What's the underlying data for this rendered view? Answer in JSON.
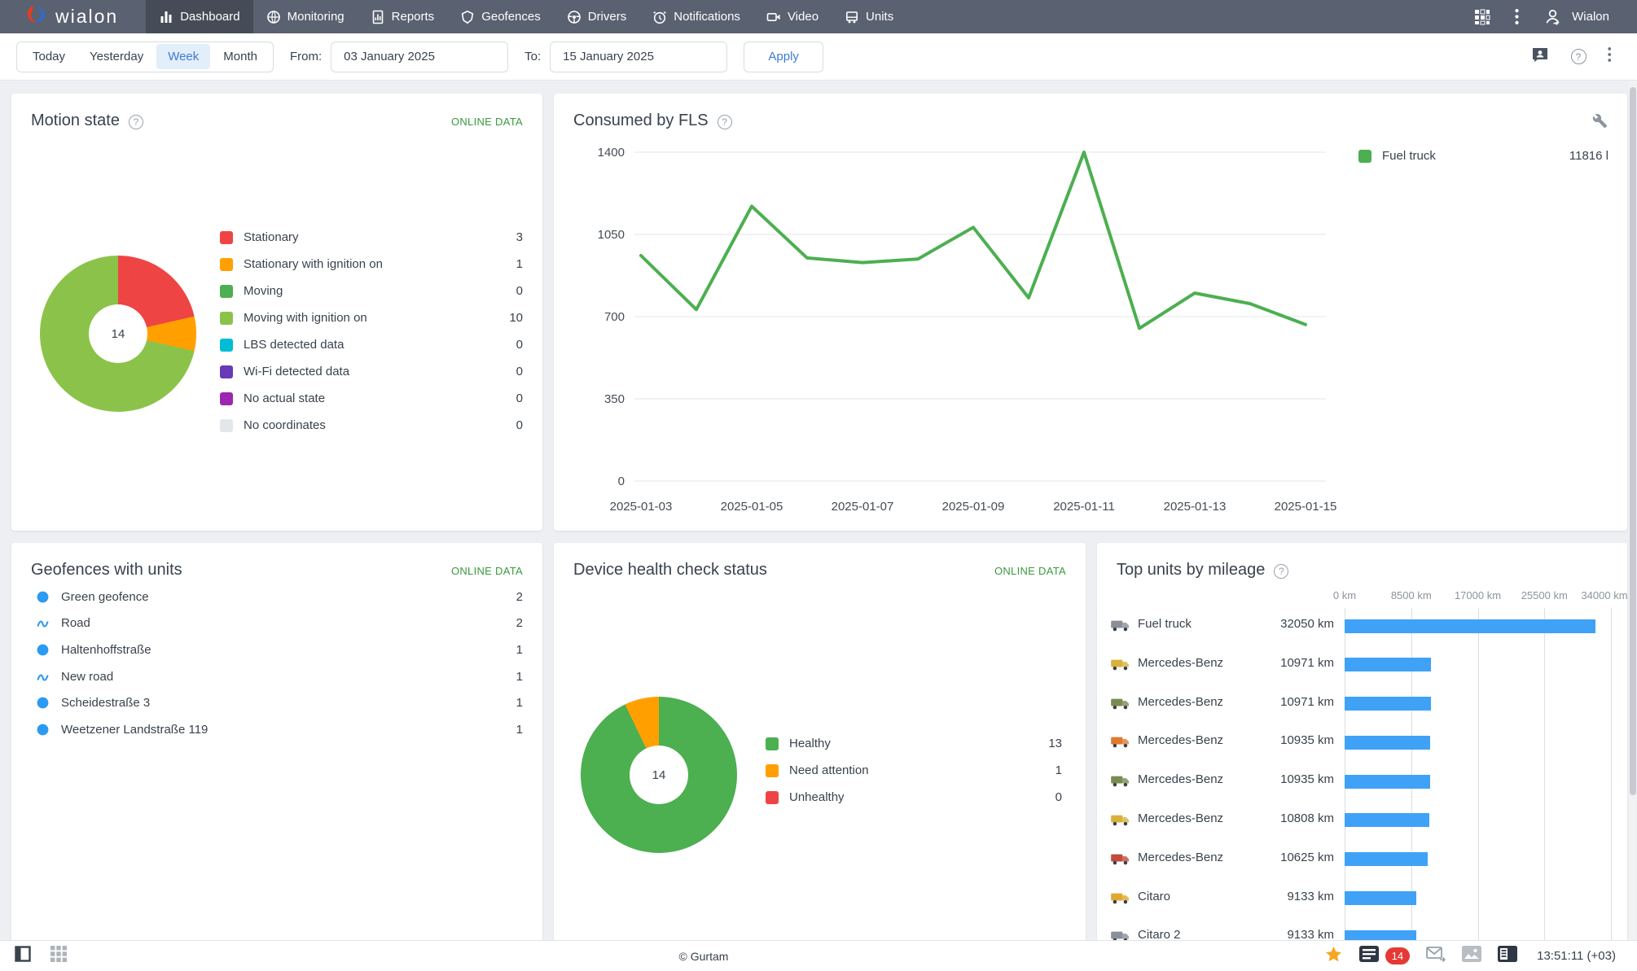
{
  "nav": {
    "brand": "wialon",
    "items": [
      {
        "label": "Dashboard",
        "icon": "dashboard-icon",
        "active": true
      },
      {
        "label": "Monitoring",
        "icon": "monitoring-icon",
        "active": false
      },
      {
        "label": "Reports",
        "icon": "reports-icon",
        "active": false
      },
      {
        "label": "Geofences",
        "icon": "geofences-icon",
        "active": false
      },
      {
        "label": "Drivers",
        "icon": "drivers-icon",
        "active": false
      },
      {
        "label": "Notifications",
        "icon": "notifications-icon",
        "active": false
      },
      {
        "label": "Video",
        "icon": "video-icon",
        "active": false
      },
      {
        "label": "Units",
        "icon": "units-icon",
        "active": false
      }
    ],
    "user_label": "Wialon"
  },
  "filterbar": {
    "ranges": [
      "Today",
      "Yesterday",
      "Week",
      "Month"
    ],
    "active_range": "Week",
    "from_label": "From:",
    "from_value": "03 January 2025",
    "to_label": "To:",
    "to_value": "15 January 2025",
    "apply_label": "Apply"
  },
  "widgets": {
    "motion_state": {
      "title": "Motion state",
      "online_data_label": "ONLINE DATA",
      "center_total": "14",
      "legend": [
        {
          "label": "Stationary",
          "count": "3",
          "color": "#ef4444"
        },
        {
          "label": "Stationary with ignition on",
          "count": "1",
          "color": "#ffa000"
        },
        {
          "label": "Moving",
          "count": "0",
          "color": "#4caf50"
        },
        {
          "label": "Moving with ignition on",
          "count": "10",
          "color": "#8bc34a"
        },
        {
          "label": "LBS detected data",
          "count": "0",
          "color": "#00bcd4"
        },
        {
          "label": "Wi-Fi detected data",
          "count": "0",
          "color": "#673ab7"
        },
        {
          "label": "No actual state",
          "count": "0",
          "color": "#9c27b0"
        },
        {
          "label": "No coordinates",
          "count": "0",
          "color": "#e4e7ea"
        }
      ]
    },
    "fls": {
      "title": "Consumed by FLS",
      "legend_name": "Fuel truck",
      "legend_value": "11816 l",
      "legend_color": "#4caf50"
    },
    "geofences": {
      "title": "Geofences with units",
      "online_data_label": "ONLINE DATA",
      "items": [
        {
          "name": "Green geofence",
          "count": "2",
          "icon": "circle-geofence-icon"
        },
        {
          "name": "Road",
          "count": "2",
          "icon": "route-geofence-icon"
        },
        {
          "name": "Haltenhoffstraße",
          "count": "1",
          "icon": "circle-geofence-icon"
        },
        {
          "name": "New road",
          "count": "1",
          "icon": "route-geofence-icon"
        },
        {
          "name": "Scheidestraße 3",
          "count": "1",
          "icon": "circle-geofence-icon"
        },
        {
          "name": "Weetzener Landstraße 119",
          "count": "1",
          "icon": "circle-geofence-icon"
        }
      ]
    },
    "health": {
      "title": "Device health check status",
      "online_data_label": "ONLINE DATA",
      "center_total": "14",
      "legend": [
        {
          "label": "Healthy",
          "count": "13",
          "color": "#4caf50"
        },
        {
          "label": "Need attention",
          "count": "1",
          "color": "#ffa000"
        },
        {
          "label": "Unhealthy",
          "count": "0",
          "color": "#ef4444"
        }
      ]
    },
    "mileage": {
      "title": "Top units by mileage",
      "axis_labels": [
        "0 km",
        "8500 km",
        "17000 km",
        "25500 km",
        "34000 km"
      ],
      "units": [
        {
          "name": "Fuel truck",
          "value_label": "32050 km",
          "value": 32050,
          "icon": "truck-icon",
          "icon_color": "#8a8f98"
        },
        {
          "name": "Mercedes-Benz",
          "value_label": "10971 km",
          "value": 10971,
          "icon": "truck-icon",
          "icon_color": "#d8b13c"
        },
        {
          "name": "Mercedes-Benz",
          "value_label": "10971 km",
          "value": 10971,
          "icon": "truck-icon",
          "icon_color": "#7a8b52"
        },
        {
          "name": "Mercedes-Benz",
          "value_label": "10935 km",
          "value": 10935,
          "icon": "truck-icon",
          "icon_color": "#e07a2f"
        },
        {
          "name": "Mercedes-Benz",
          "value_label": "10935 km",
          "value": 10935,
          "icon": "truck-icon",
          "icon_color": "#7a8b52"
        },
        {
          "name": "Mercedes-Benz",
          "value_label": "10808 km",
          "value": 10808,
          "icon": "truck-icon",
          "icon_color": "#d8b13c"
        },
        {
          "name": "Mercedes-Benz",
          "value_label": "10625 km",
          "value": 10625,
          "icon": "truck-icon",
          "icon_color": "#c24b3a"
        },
        {
          "name": "Citaro",
          "value_label": "9133 km",
          "value": 9133,
          "icon": "truck-icon",
          "icon_color": "#e0a82e"
        },
        {
          "name": "Citaro 2",
          "value_label": "9133 km",
          "value": 9133,
          "icon": "truck-icon",
          "icon_color": "#8a8f98"
        }
      ],
      "bar_color": "#3fa2f7"
    }
  },
  "footer": {
    "copyright": "© Gurtam",
    "notifications_count": "14",
    "time": "13:51:11 (+03)"
  },
  "chart_data": [
    {
      "id": "motion-pie",
      "type": "pie",
      "title": "Motion state",
      "labels": [
        "Stationary",
        "Stationary with ignition on",
        "Moving",
        "Moving with ignition on",
        "LBS detected data",
        "Wi-Fi detected data",
        "No actual state",
        "No coordinates"
      ],
      "values": [
        3,
        1,
        0,
        10,
        0,
        0,
        0,
        0
      ],
      "colors": [
        "#ef4444",
        "#ffa000",
        "#4caf50",
        "#8bc34a",
        "#00bcd4",
        "#673ab7",
        "#9c27b0",
        "#e4e7ea"
      ],
      "center_label": "14"
    },
    {
      "id": "fls-line",
      "type": "line",
      "title": "Consumed by FLS",
      "x": [
        "2025-01-03",
        "2025-01-04",
        "2025-01-05",
        "2025-01-06",
        "2025-01-07",
        "2025-01-08",
        "2025-01-09",
        "2025-01-10",
        "2025-01-11",
        "2025-01-12",
        "2025-01-13",
        "2025-01-14",
        "2025-01-15"
      ],
      "series": [
        {
          "name": "Fuel truck",
          "total_label": "11816 l",
          "values": [
            960,
            730,
            1170,
            950,
            930,
            945,
            1080,
            780,
            1400,
            650,
            800,
            755,
            666
          ]
        }
      ],
      "ylim": [
        0,
        1400
      ],
      "yticks": [
        0,
        350,
        700,
        1050,
        1400
      ],
      "x_tick_labels": [
        "2025-01-03",
        "2025-01-05",
        "2025-01-07",
        "2025-01-09",
        "2025-01-11",
        "2025-01-13",
        "2025-01-15"
      ],
      "color": "#4caf50",
      "grid": "horizontal",
      "legend_position": "right"
    },
    {
      "id": "health-pie",
      "type": "pie",
      "title": "Device health check status",
      "labels": [
        "Healthy",
        "Need attention",
        "Unhealthy"
      ],
      "values": [
        13,
        1,
        0
      ],
      "colors": [
        "#4caf50",
        "#ffa000",
        "#ef4444"
      ],
      "center_label": "14"
    },
    {
      "id": "mileage-bars",
      "type": "bar",
      "title": "Top units by mileage",
      "orientation": "horizontal",
      "categories": [
        "Fuel truck",
        "Mercedes-Benz",
        "Mercedes-Benz",
        "Mercedes-Benz",
        "Mercedes-Benz",
        "Mercedes-Benz",
        "Mercedes-Benz",
        "Citaro",
        "Citaro 2"
      ],
      "values": [
        32050,
        10971,
        10971,
        10935,
        10935,
        10808,
        10625,
        9133,
        9133
      ],
      "xlim": [
        0,
        34000
      ],
      "xticks": [
        0,
        8500,
        17000,
        25500,
        34000
      ],
      "bar_color": "#3fa2f7"
    }
  ]
}
